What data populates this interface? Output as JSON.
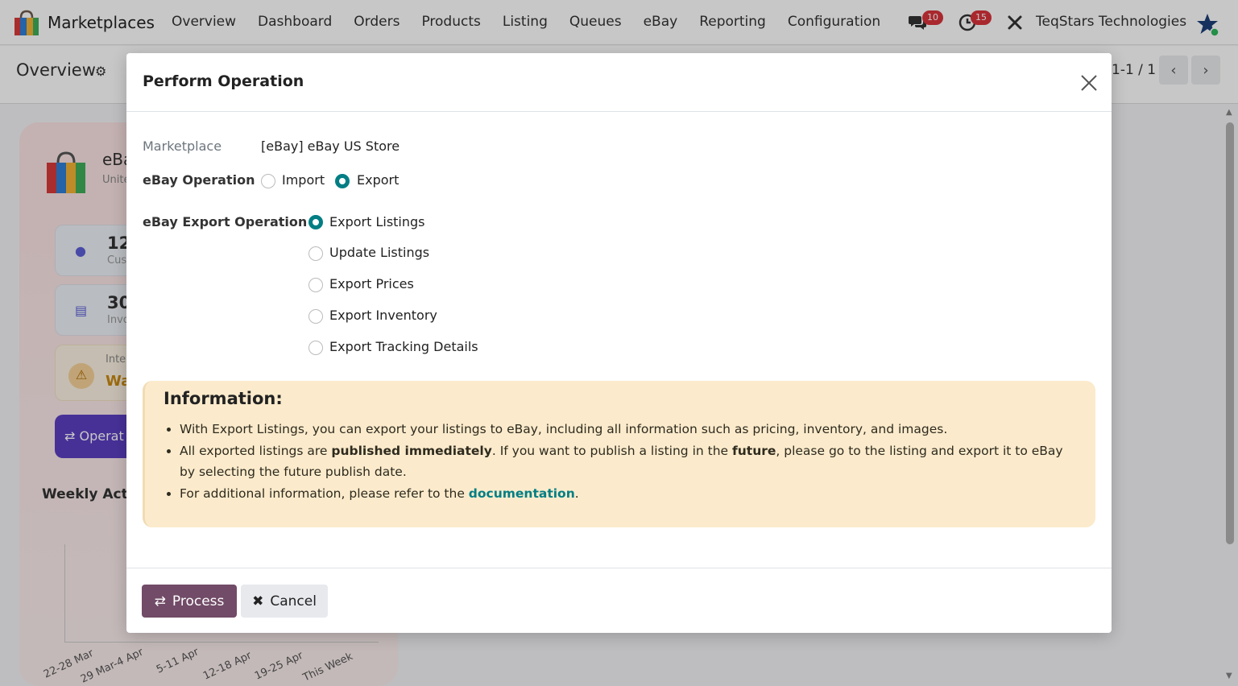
{
  "navbar": {
    "app_name": "Marketplaces",
    "menu": [
      "Overview",
      "Dashboard",
      "Orders",
      "Products",
      "Listing",
      "Queues",
      "eBay",
      "Reporting",
      "Configuration"
    ],
    "chat_count": "10",
    "activity_count": "15",
    "company": "TeqStars Technologies"
  },
  "control_panel": {
    "title": "Overview",
    "pager": "1-1 / 1"
  },
  "background": {
    "marketplace_name": "eBa",
    "marketplace_sub": "Unite",
    "stats": [
      {
        "value": "12",
        "label": "Cus"
      },
      {
        "value": "30",
        "label": "Invo"
      }
    ],
    "warning_label": "Inte",
    "warning_value": "Wa",
    "operations_button": "Operat",
    "weekly_title": "Weekly Activi",
    "ticks": [
      "22-28 Mar",
      "29 Mar-4 Apr",
      "5-11 Apr",
      "12-18 Apr",
      "19-25 Apr",
      "This Week"
    ]
  },
  "modal": {
    "title": "Perform Operation",
    "marketplace_label": "Marketplace",
    "marketplace_value": "[eBay] eBay US Store",
    "operation_label": "eBay Operation",
    "operation_options": [
      {
        "label": "Import",
        "selected": false
      },
      {
        "label": "Export",
        "selected": true
      }
    ],
    "export_label": "eBay Export Operation",
    "export_options": [
      {
        "label": "Export Listings",
        "selected": true
      },
      {
        "label": "Update Listings",
        "selected": false
      },
      {
        "label": "Export Prices",
        "selected": false
      },
      {
        "label": "Export Inventory",
        "selected": false
      },
      {
        "label": "Export Tracking Details",
        "selected": false
      }
    ],
    "info": {
      "title": "Information:",
      "line1": "With Export Listings, you can export your listings to eBay, including all information such as pricing, inventory, and images.",
      "line2_a": "All exported listings are ",
      "line2_b": "published immediately",
      "line2_c": ". If you want to publish a listing in the ",
      "line2_d": "future",
      "line2_e": ", please go to the listing and export it to eBay by selecting the future publish date.",
      "line3_a": "For additional information, please refer to the ",
      "line3_link": "documentation",
      "line3_b": "."
    },
    "process_label": "Process",
    "cancel_label": "Cancel"
  },
  "colors": {
    "accent": "#714b67",
    "teal": "#017e84",
    "info_bg": "#fbebcc"
  }
}
